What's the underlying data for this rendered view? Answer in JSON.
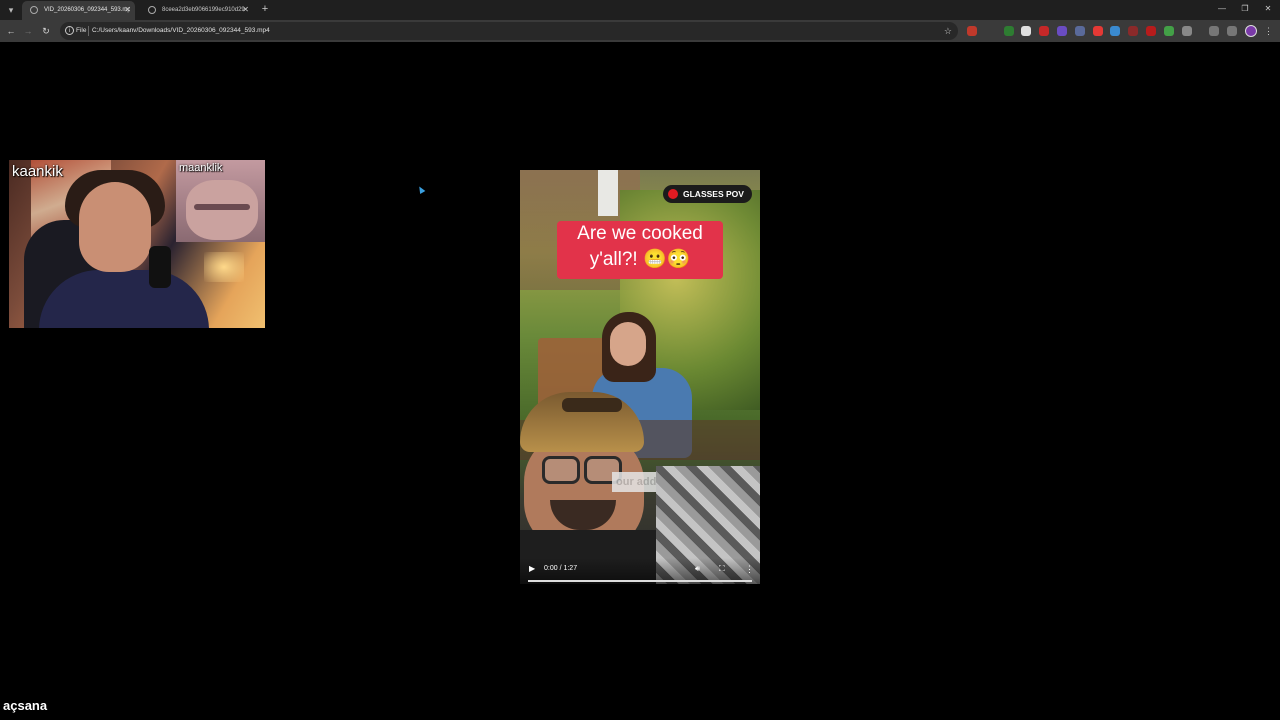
{
  "browser": {
    "tabs": [
      {
        "title": "VID_20260306_092344_593.mp4",
        "active": true
      },
      {
        "title": "8ceea2d3eb9066199ec910d29",
        "active": false
      }
    ],
    "address": {
      "scheme_label": "File",
      "url": "C:/Users/kaanv/Downloads/VID_20260306_092344_593.mp4"
    },
    "icons": {
      "tab_menu": "chevron-down-icon",
      "new_tab": "plus-icon",
      "back": "arrow-left-icon",
      "forward": "arrow-right-icon",
      "reload": "reload-icon",
      "bookmark": "star-icon"
    }
  },
  "facecam": {
    "streamer_name": "kaankik",
    "guest_name": "maanklik"
  },
  "video": {
    "badge": "GLASSES POV",
    "caption_line1": "Are we cooked",
    "caption_line2": "y'all?! 😬😳",
    "sign_text": "our address",
    "time": "0:00 / 1:27",
    "progress": 0
  },
  "watermark": "açsana",
  "colors": {
    "caption_bg": "#e2334a",
    "badge_dot": "#e21b22",
    "tabbar": "#1f1f1f",
    "toolbar": "#3a3a3a"
  }
}
